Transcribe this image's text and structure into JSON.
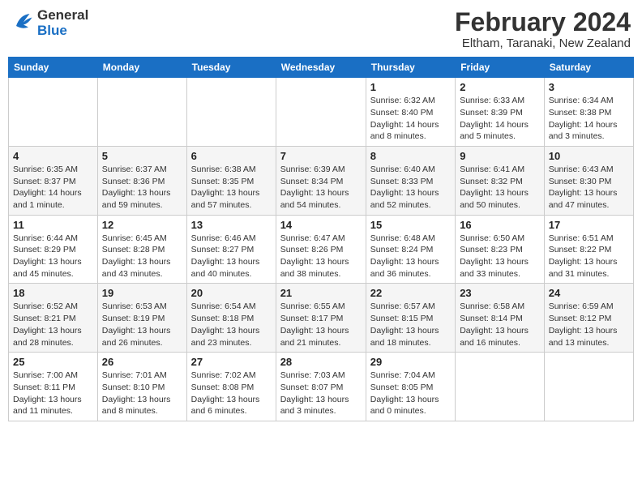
{
  "header": {
    "logo_line1": "General",
    "logo_line2": "Blue",
    "month_year": "February 2024",
    "location": "Eltham, Taranaki, New Zealand"
  },
  "days_of_week": [
    "Sunday",
    "Monday",
    "Tuesday",
    "Wednesday",
    "Thursday",
    "Friday",
    "Saturday"
  ],
  "weeks": [
    [
      {
        "day": "",
        "info": ""
      },
      {
        "day": "",
        "info": ""
      },
      {
        "day": "",
        "info": ""
      },
      {
        "day": "",
        "info": ""
      },
      {
        "day": "1",
        "info": "Sunrise: 6:32 AM\nSunset: 8:40 PM\nDaylight: 14 hours\nand 8 minutes."
      },
      {
        "day": "2",
        "info": "Sunrise: 6:33 AM\nSunset: 8:39 PM\nDaylight: 14 hours\nand 5 minutes."
      },
      {
        "day": "3",
        "info": "Sunrise: 6:34 AM\nSunset: 8:38 PM\nDaylight: 14 hours\nand 3 minutes."
      }
    ],
    [
      {
        "day": "4",
        "info": "Sunrise: 6:35 AM\nSunset: 8:37 PM\nDaylight: 14 hours\nand 1 minute."
      },
      {
        "day": "5",
        "info": "Sunrise: 6:37 AM\nSunset: 8:36 PM\nDaylight: 13 hours\nand 59 minutes."
      },
      {
        "day": "6",
        "info": "Sunrise: 6:38 AM\nSunset: 8:35 PM\nDaylight: 13 hours\nand 57 minutes."
      },
      {
        "day": "7",
        "info": "Sunrise: 6:39 AM\nSunset: 8:34 PM\nDaylight: 13 hours\nand 54 minutes."
      },
      {
        "day": "8",
        "info": "Sunrise: 6:40 AM\nSunset: 8:33 PM\nDaylight: 13 hours\nand 52 minutes."
      },
      {
        "day": "9",
        "info": "Sunrise: 6:41 AM\nSunset: 8:32 PM\nDaylight: 13 hours\nand 50 minutes."
      },
      {
        "day": "10",
        "info": "Sunrise: 6:43 AM\nSunset: 8:30 PM\nDaylight: 13 hours\nand 47 minutes."
      }
    ],
    [
      {
        "day": "11",
        "info": "Sunrise: 6:44 AM\nSunset: 8:29 PM\nDaylight: 13 hours\nand 45 minutes."
      },
      {
        "day": "12",
        "info": "Sunrise: 6:45 AM\nSunset: 8:28 PM\nDaylight: 13 hours\nand 43 minutes."
      },
      {
        "day": "13",
        "info": "Sunrise: 6:46 AM\nSunset: 8:27 PM\nDaylight: 13 hours\nand 40 minutes."
      },
      {
        "day": "14",
        "info": "Sunrise: 6:47 AM\nSunset: 8:26 PM\nDaylight: 13 hours\nand 38 minutes."
      },
      {
        "day": "15",
        "info": "Sunrise: 6:48 AM\nSunset: 8:24 PM\nDaylight: 13 hours\nand 36 minutes."
      },
      {
        "day": "16",
        "info": "Sunrise: 6:50 AM\nSunset: 8:23 PM\nDaylight: 13 hours\nand 33 minutes."
      },
      {
        "day": "17",
        "info": "Sunrise: 6:51 AM\nSunset: 8:22 PM\nDaylight: 13 hours\nand 31 minutes."
      }
    ],
    [
      {
        "day": "18",
        "info": "Sunrise: 6:52 AM\nSunset: 8:21 PM\nDaylight: 13 hours\nand 28 minutes."
      },
      {
        "day": "19",
        "info": "Sunrise: 6:53 AM\nSunset: 8:19 PM\nDaylight: 13 hours\nand 26 minutes."
      },
      {
        "day": "20",
        "info": "Sunrise: 6:54 AM\nSunset: 8:18 PM\nDaylight: 13 hours\nand 23 minutes."
      },
      {
        "day": "21",
        "info": "Sunrise: 6:55 AM\nSunset: 8:17 PM\nDaylight: 13 hours\nand 21 minutes."
      },
      {
        "day": "22",
        "info": "Sunrise: 6:57 AM\nSunset: 8:15 PM\nDaylight: 13 hours\nand 18 minutes."
      },
      {
        "day": "23",
        "info": "Sunrise: 6:58 AM\nSunset: 8:14 PM\nDaylight: 13 hours\nand 16 minutes."
      },
      {
        "day": "24",
        "info": "Sunrise: 6:59 AM\nSunset: 8:12 PM\nDaylight: 13 hours\nand 13 minutes."
      }
    ],
    [
      {
        "day": "25",
        "info": "Sunrise: 7:00 AM\nSunset: 8:11 PM\nDaylight: 13 hours\nand 11 minutes."
      },
      {
        "day": "26",
        "info": "Sunrise: 7:01 AM\nSunset: 8:10 PM\nDaylight: 13 hours\nand 8 minutes."
      },
      {
        "day": "27",
        "info": "Sunrise: 7:02 AM\nSunset: 8:08 PM\nDaylight: 13 hours\nand 6 minutes."
      },
      {
        "day": "28",
        "info": "Sunrise: 7:03 AM\nSunset: 8:07 PM\nDaylight: 13 hours\nand 3 minutes."
      },
      {
        "day": "29",
        "info": "Sunrise: 7:04 AM\nSunset: 8:05 PM\nDaylight: 13 hours\nand 0 minutes."
      },
      {
        "day": "",
        "info": ""
      },
      {
        "day": "",
        "info": ""
      }
    ]
  ]
}
